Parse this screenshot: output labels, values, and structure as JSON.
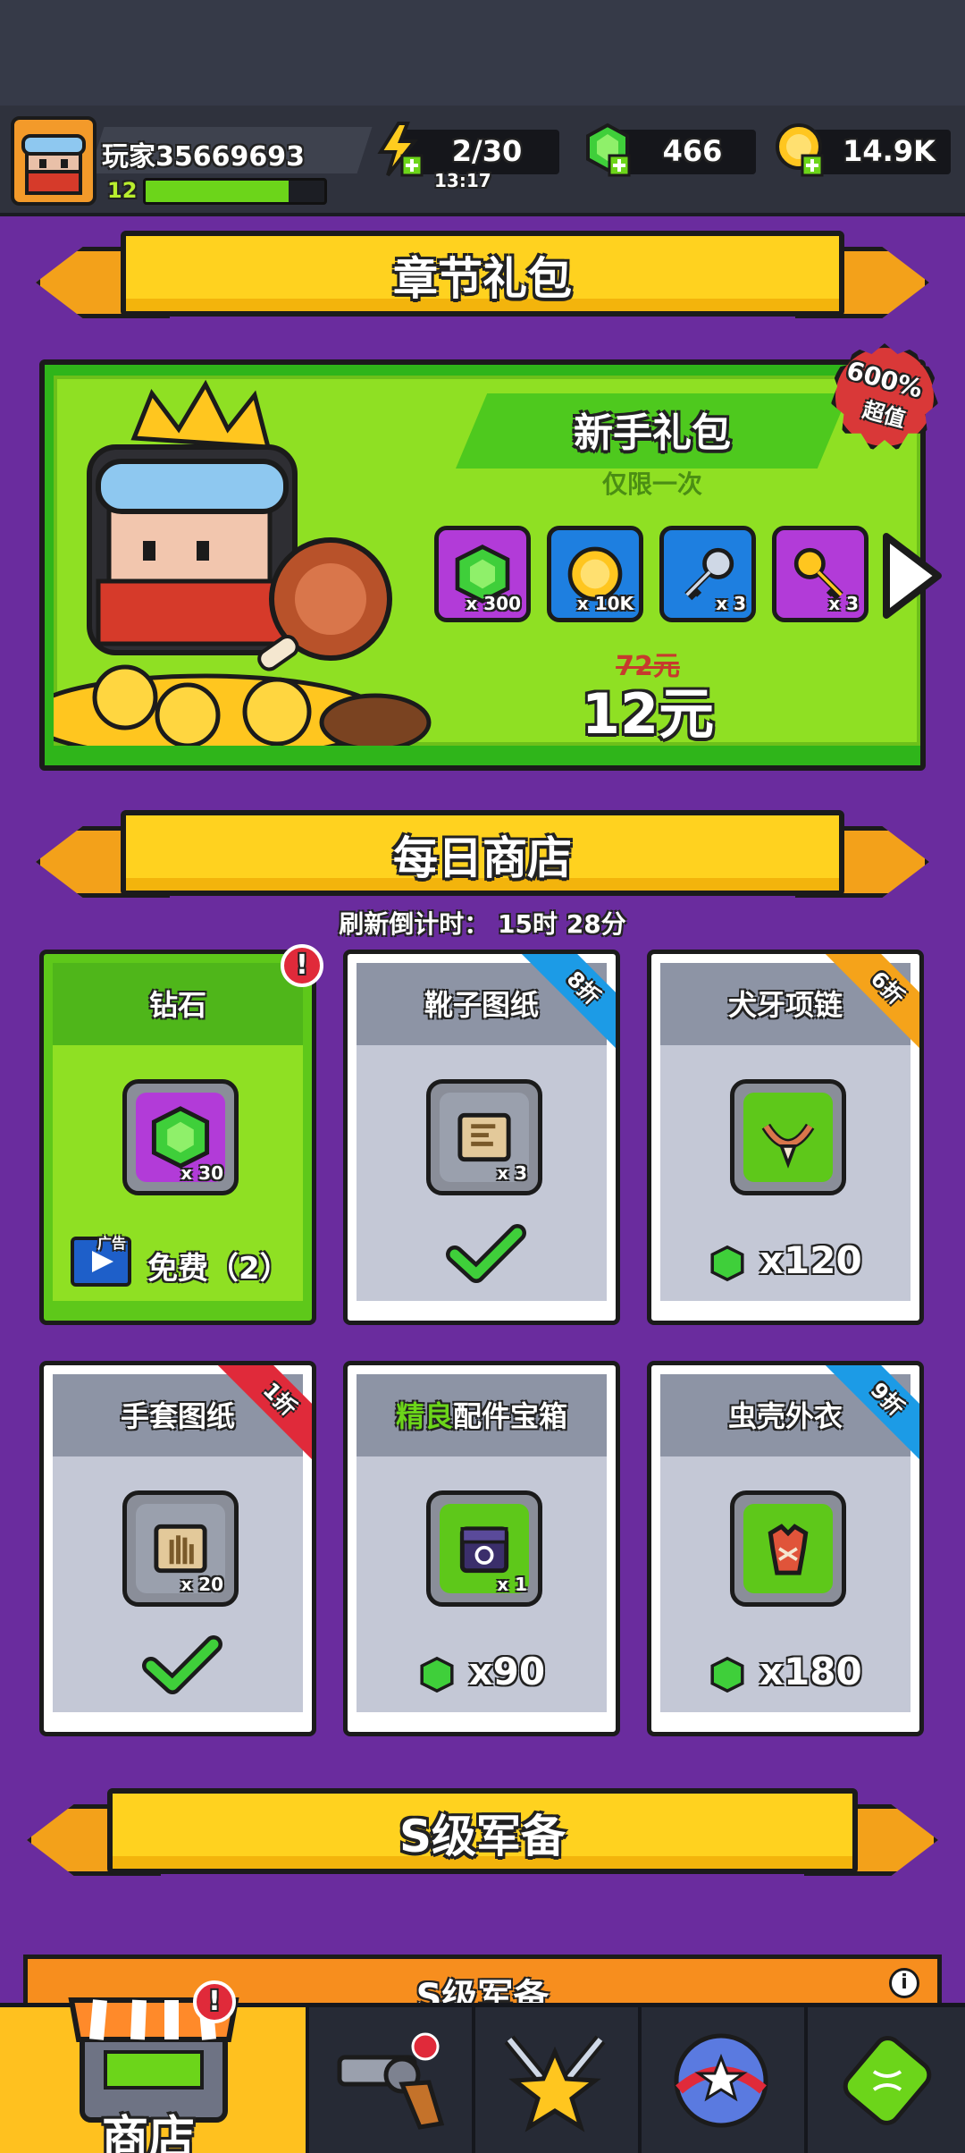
{
  "header": {
    "player_name": "玩家35669693",
    "level": "12",
    "xp_percent": 80,
    "energy": "2/30",
    "energy_timer": "13:17",
    "gems": "466",
    "coins": "14.9K"
  },
  "chapter_pack": {
    "banner": "章节礼包",
    "title": "新手礼包",
    "subtitle": "仅限一次",
    "badge_pct": "600%",
    "badge_word": "超值",
    "items": [
      {
        "name": "gem-icon",
        "count": "x 300",
        "color": "#b23bd8"
      },
      {
        "name": "coin-icon",
        "count": "x 10K",
        "color": "#1e7fe0"
      },
      {
        "name": "silver-key-icon",
        "count": "x 3",
        "color": "#1e7fe0"
      },
      {
        "name": "gold-key-icon",
        "count": "x 3",
        "color": "#b23bd8"
      }
    ],
    "old_price": "72元",
    "new_price": "12元"
  },
  "daily_shop": {
    "banner": "每日商店",
    "refresh": "刷新倒计时： 15时 28分",
    "cards": [
      {
        "title": "钻石",
        "count": "x 30",
        "ad_label": "广告",
        "price": "免费（2）",
        "state": "free"
      },
      {
        "title": "靴子图纸",
        "count": "x 3",
        "corner": "8折",
        "state": "bought"
      },
      {
        "title": "犬牙项链",
        "corner": "6折",
        "price": "x120",
        "state": "buy"
      },
      {
        "title": "手套图纸",
        "count": "x 20",
        "corner": "1折",
        "state": "bought"
      },
      {
        "title_green": "精良",
        "title_rest": "配件宝箱",
        "count": "x 1",
        "price": "x90",
        "state": "buy"
      },
      {
        "title": "虫壳外衣",
        "corner": "9折",
        "price": "x180",
        "state": "buy"
      }
    ]
  },
  "s_gear": {
    "banner": "S级军备",
    "peek": "S级军备"
  },
  "nav": {
    "shop": "商店"
  },
  "colors": {
    "purple": "#6a2c9e",
    "yellow": "#ffd21f",
    "green": "#8fe023",
    "red": "#e02a3a"
  }
}
